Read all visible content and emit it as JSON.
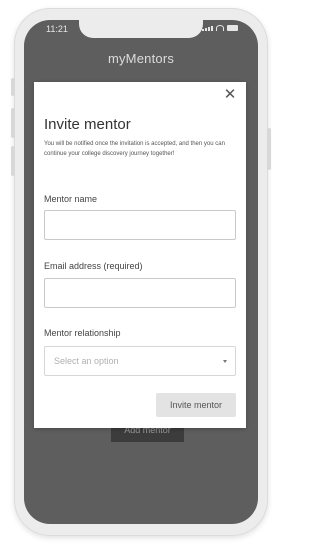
{
  "status_bar": {
    "time": "11:21"
  },
  "app": {
    "title": "myMentors",
    "add_mentor_label": "Add mentor"
  },
  "modal": {
    "title": "Invite mentor",
    "description": "You will be notified once the invitation is accepted, and then you can continue your college discovery journey together!",
    "close_icon": "close-icon",
    "fields": {
      "mentor_name": {
        "label": "Mentor name",
        "value": ""
      },
      "email": {
        "label": "Email address (required)",
        "value": ""
      },
      "relationship": {
        "label": "Mentor relationship",
        "placeholder": "Select an option"
      }
    },
    "submit_label": "Invite mentor"
  },
  "colors": {
    "overlay": "#5e5e5e",
    "modal_bg": "#ffffff",
    "button_bg": "#e3e3e3",
    "add_button_bg": "#3c3c3c"
  }
}
